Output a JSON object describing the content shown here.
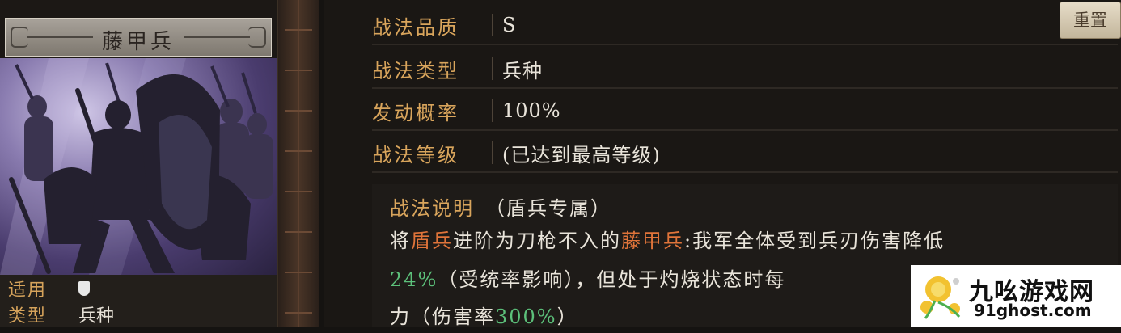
{
  "card": {
    "title": "藤甲兵",
    "info": {
      "applicable_label": "适用",
      "applicable_icon": "shield-icon",
      "type_label": "类型",
      "type_value": "兵种"
    }
  },
  "attributes": {
    "quality": {
      "label": "战法品质",
      "value": "S"
    },
    "type": {
      "label": "战法类型",
      "value": "兵种"
    },
    "rate": {
      "label": "发动概率",
      "value": "100%"
    },
    "level": {
      "label": "战法等级",
      "value": "(已达到最高等级)"
    }
  },
  "reset_label": "重置",
  "description": {
    "label": "战法说明",
    "note": "（盾兵专属）",
    "line1": {
      "p1": "将",
      "h1": "盾兵",
      "p2": "进阶为刀枪不入的",
      "h2": "藤甲兵",
      "p3": ":我军全体受到兵刃伤害降低"
    },
    "line2": {
      "pct": "24%",
      "rest": "（受统率影响），但处于灼烧状态时每"
    },
    "line3": {
      "p1": "力（伤害率",
      "pct": "300%",
      "p2": "）"
    }
  },
  "watermark": {
    "name": "九吆游戏网",
    "url": "91ghost.com"
  },
  "colors": {
    "label_gold": "#d9a55c",
    "highlight_orange": "#e0743a",
    "highlight_green": "#5cc07a"
  }
}
